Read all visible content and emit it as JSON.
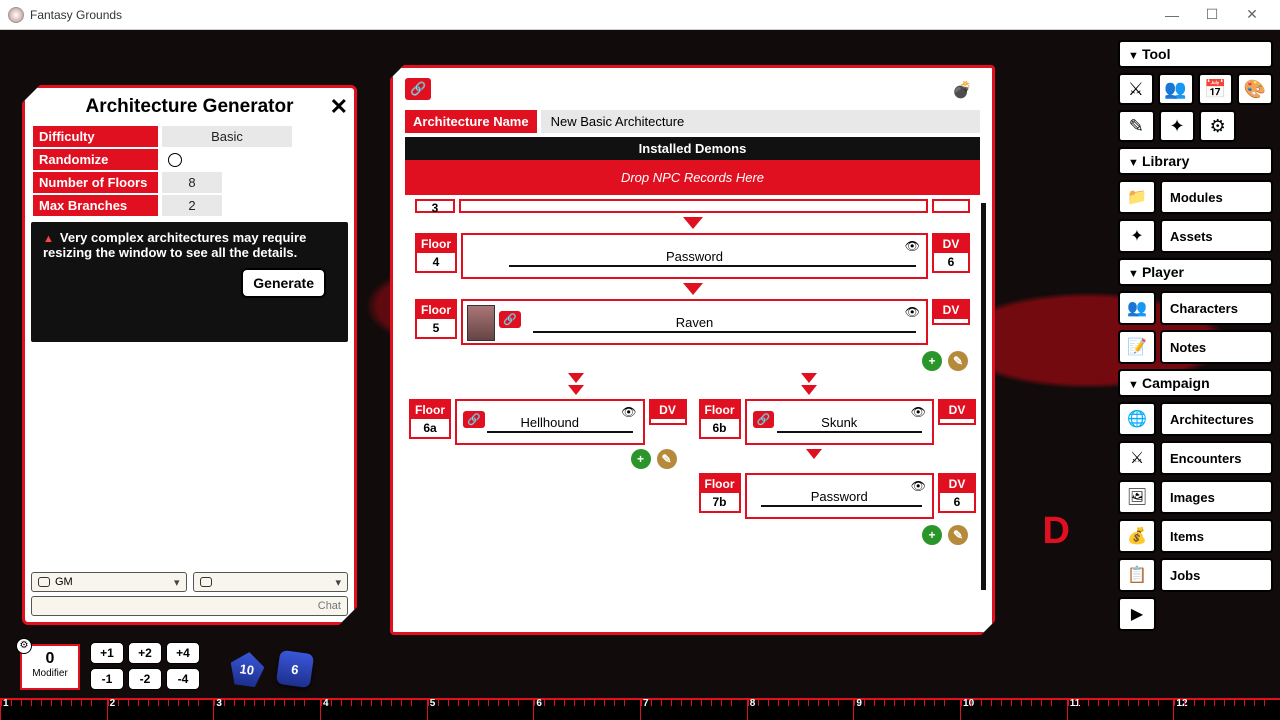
{
  "app": {
    "title": "Fantasy Grounds"
  },
  "window_controls": {
    "min": "—",
    "max": "☐",
    "close": "✕"
  },
  "sidebar": {
    "section_tool": "Tool",
    "tool_icons": [
      "⚔",
      "👥",
      "📅",
      "🎨",
      "✎",
      "✦",
      "⚙"
    ],
    "section_library": "Library",
    "library": [
      {
        "icon": "📁",
        "label": "Modules"
      },
      {
        "icon": "✦",
        "label": "Assets"
      }
    ],
    "section_player": "Player",
    "player": [
      {
        "icon": "👥",
        "label": "Characters"
      },
      {
        "icon": "📝",
        "label": "Notes"
      }
    ],
    "section_campaign": "Campaign",
    "campaign": [
      {
        "icon": "🌐",
        "label": "Architectures"
      },
      {
        "icon": "⚔",
        "label": "Encounters"
      },
      {
        "icon": "🖼",
        "label": "Images"
      },
      {
        "icon": "💰",
        "label": "Items"
      },
      {
        "icon": "📋",
        "label": "Jobs"
      }
    ],
    "play_icon": "▶"
  },
  "generator": {
    "title": "Architecture Generator",
    "rows": {
      "difficulty": {
        "k": "Difficulty",
        "v": "Basic"
      },
      "randomize": {
        "k": "Randomize"
      },
      "floors": {
        "k": "Number of Floors",
        "v": "8"
      },
      "branches": {
        "k": "Max Branches",
        "v": "2"
      }
    },
    "warning": "Very complex architectures may require resizing the window to see all the details.",
    "generate_btn": "Generate",
    "chat": {
      "gm": "GM",
      "chat_label": "Chat"
    }
  },
  "architecture": {
    "name_k": "Architecture Name",
    "name_v": "New Basic Architecture",
    "demons_header": "Installed Demons",
    "drop_hint": "Drop NPC Records Here",
    "floor_label": "Floor",
    "dv_label": "DV",
    "topsliver_floor": "3",
    "nodes": {
      "f4": {
        "floor": "4",
        "label": "Password",
        "dv": "6"
      },
      "f5": {
        "floor": "5",
        "label": "Raven",
        "dv": ""
      },
      "f6a": {
        "floor": "6a",
        "label": "Hellhound",
        "dv": ""
      },
      "f6b": {
        "floor": "6b",
        "label": "Skunk",
        "dv": ""
      },
      "f7b": {
        "floor": "7b",
        "label": "Password",
        "dv": "6"
      }
    }
  },
  "bottom": {
    "modifier_value": "0",
    "modifier_label": "Modifier",
    "pm": [
      "+1",
      "+2",
      "+4",
      "-1",
      "-2",
      "-4"
    ],
    "d10": "10",
    "d6": "6",
    "ruler": [
      "1",
      "2",
      "3",
      "4",
      "5",
      "6",
      "7",
      "8",
      "9",
      "10",
      "11",
      "12"
    ]
  },
  "decor": {
    "letter": "D"
  }
}
